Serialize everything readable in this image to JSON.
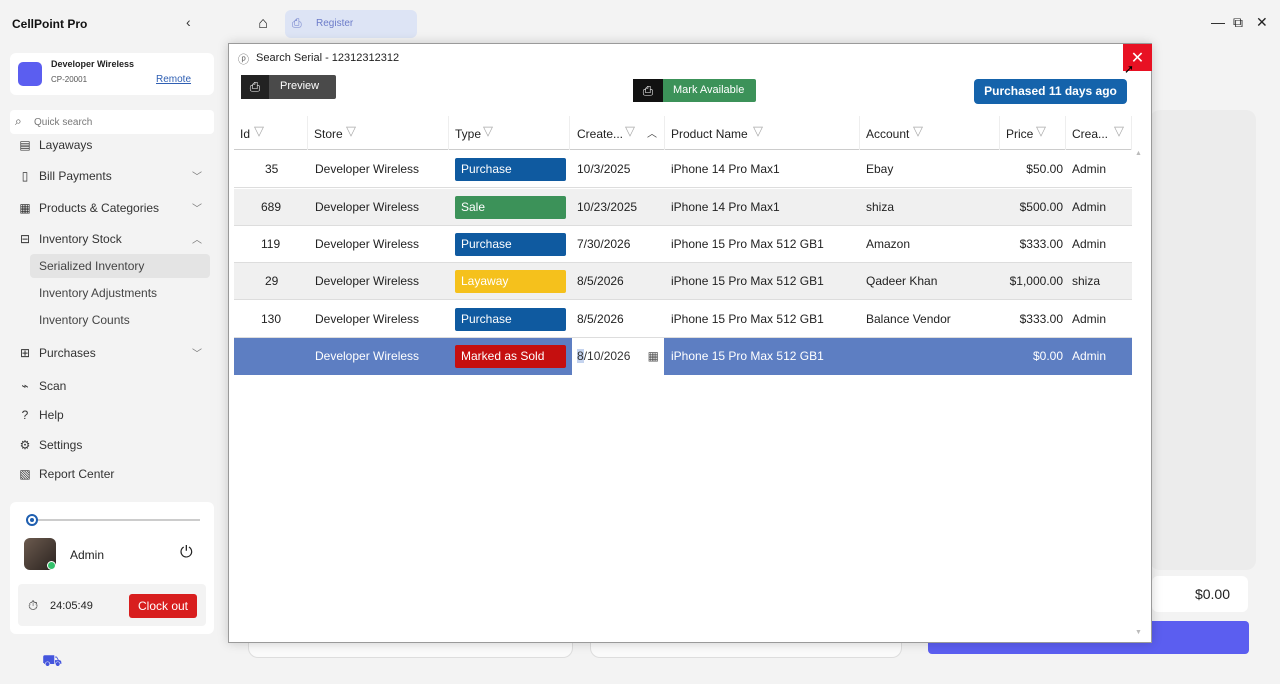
{
  "app": {
    "title": "CellPoint Pro",
    "collapse_glyph": "‹",
    "window_controls": {
      "minimize": "—",
      "restore": "⧉",
      "close": "✕"
    }
  },
  "store": {
    "name": "Developer Wireless",
    "id": "CP-20001",
    "remote_label": "Remote"
  },
  "sidebar": {
    "search_placeholder": "Quick search",
    "items": [
      {
        "label": "Layaways",
        "icon": "layaways-icon",
        "glyph": "▤"
      },
      {
        "label": "Bill Payments",
        "icon": "bill-payments-icon",
        "glyph": "▯"
      },
      {
        "label": "Products & Categories",
        "icon": "products-icon",
        "glyph": "▦"
      },
      {
        "label": "Inventory Stock",
        "icon": "inventory-icon",
        "glyph": "⊟"
      },
      {
        "label": "Purchases",
        "icon": "purchases-icon",
        "glyph": "⊞"
      },
      {
        "label": "Scan",
        "icon": "scan-icon",
        "glyph": "⌁"
      },
      {
        "label": "Help",
        "icon": "help-icon",
        "glyph": "?"
      },
      {
        "label": "Settings",
        "icon": "settings-icon",
        "glyph": "⚙"
      },
      {
        "label": "Report Center",
        "icon": "report-icon",
        "glyph": "▧"
      }
    ],
    "subitems": [
      {
        "label": "Serialized Inventory"
      },
      {
        "label": "Inventory Adjustments"
      },
      {
        "label": "Inventory Counts"
      }
    ]
  },
  "user": {
    "name": "Admin",
    "timer": "24:05:49",
    "clockout_label": "Clock out"
  },
  "topbar": {
    "tab_label": "Register"
  },
  "background": {
    "total": "$0.00"
  },
  "modal": {
    "title": "Search Serial - 12312312312",
    "preview_label": "Preview",
    "mark_available_label": "Mark Available",
    "purchased_badge": "Purchased 11 days ago"
  },
  "grid": {
    "columns": [
      "Id",
      "Store",
      "Type",
      "Create...",
      "Product Name",
      "Account",
      "Price",
      "Crea..."
    ],
    "rows": [
      {
        "id": "35",
        "store": "Developer Wireless",
        "type": "Purchase",
        "type_color": "#0f5aa0",
        "created": "10/3/2025",
        "product": "iPhone 14 Pro Max1",
        "account": "Ebay",
        "price": "$50.00",
        "creator": "Admin"
      },
      {
        "id": "689",
        "store": "Developer Wireless",
        "type": "Sale",
        "type_color": "#3c9259",
        "created": "10/23/2025",
        "product": "iPhone 14 Pro Max1",
        "account": "shiza",
        "price": "$500.00",
        "creator": "Admin"
      },
      {
        "id": "119",
        "store": "Developer Wireless",
        "type": "Purchase",
        "type_color": "#0f5aa0",
        "created": "7/30/2026",
        "product": "iPhone 15 Pro Max 512 GB1",
        "account": "Amazon",
        "price": "$333.00",
        "creator": "Admin"
      },
      {
        "id": "29",
        "store": "Developer Wireless",
        "type": "Layaway",
        "type_color": "#f5c11c",
        "created": "8/5/2026",
        "product": "iPhone 15 Pro Max 512 GB1",
        "account": "Qadeer Khan",
        "price": "$1,000.00",
        "creator": "shiza"
      },
      {
        "id": "130",
        "store": "Developer Wireless",
        "type": "Purchase",
        "type_color": "#0f5aa0",
        "created": "8/5/2026",
        "product": "iPhone 15 Pro Max 512 GB1",
        "account": "Balance Vendor",
        "price": "$333.00",
        "creator": "Admin"
      },
      {
        "id": "",
        "store": "Developer Wireless",
        "type": "Marked as Sold",
        "type_color": "#c50f0f",
        "created_caret": "8",
        "created_rest": "/10/2026",
        "product": "iPhone 15 Pro Max 512 GB1",
        "account": "",
        "price": "$0.00",
        "creator": "Admin"
      }
    ]
  }
}
